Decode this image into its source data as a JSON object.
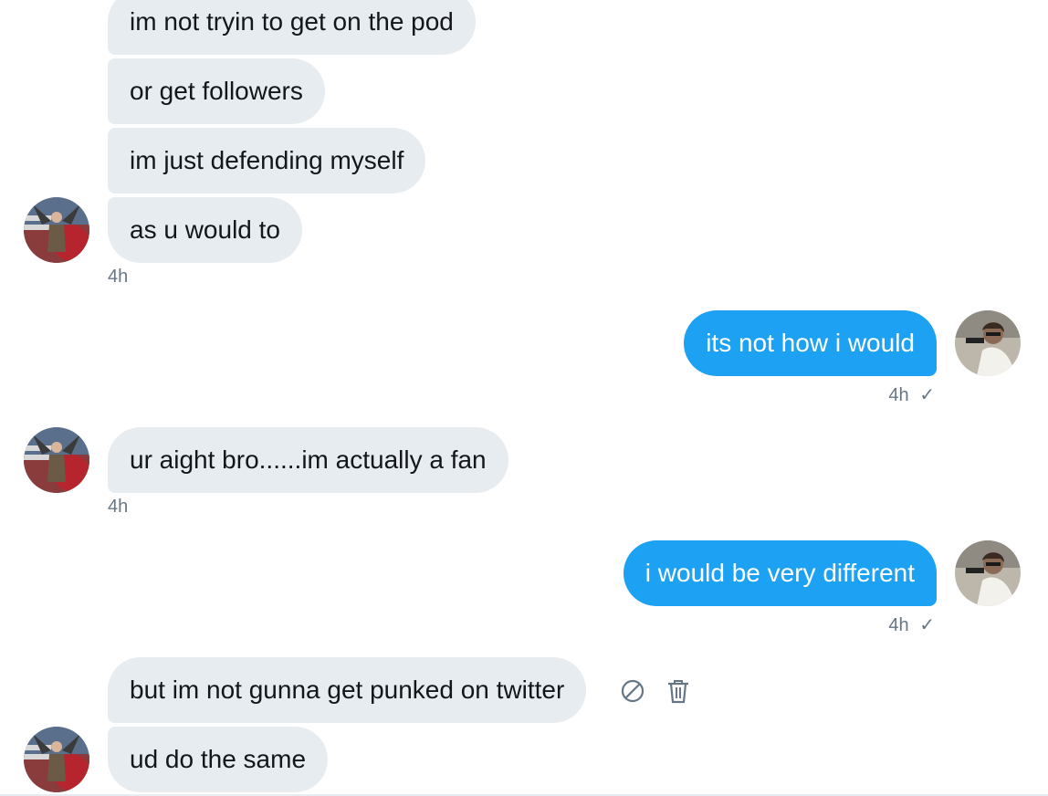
{
  "conversation": {
    "group1": {
      "messages": [
        "im not tryin to get on the pod",
        "or get followers",
        "im just defending myself",
        "as u would to"
      ],
      "time": "4h"
    },
    "reply1": {
      "text": "its not how i would",
      "time": "4h",
      "check": "✓"
    },
    "group2": {
      "text": "ur aight bro......im actually a fan",
      "time": "4h"
    },
    "reply2": {
      "text": "i would be very different",
      "time": "4h",
      "check": "✓"
    },
    "group3": {
      "messages": [
        "but im not gunna get punked on twitter",
        "ud do the same"
      ]
    }
  },
  "icons": {
    "block": "block-icon",
    "delete": "trash-icon"
  },
  "colors": {
    "incoming_bubble": "#e6ecf0",
    "outgoing_bubble": "#1da1f2",
    "meta_text": "#657786"
  }
}
